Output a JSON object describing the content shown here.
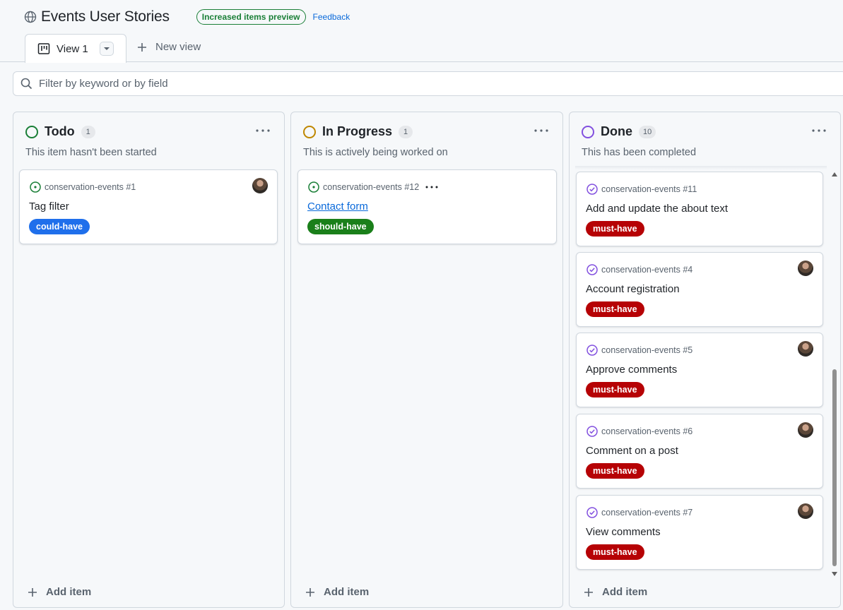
{
  "header": {
    "title": "Events User Stories",
    "preview_badge": "Increased items preview",
    "feedback_link": "Feedback",
    "icon": "globe-icon"
  },
  "tabs": {
    "active_label": "View 1",
    "new_view_label": "New view"
  },
  "filter": {
    "placeholder": "Filter by keyword or by field"
  },
  "columns": [
    {
      "name": "Todo",
      "count": "1",
      "description": "This item hasn't been started",
      "status_color": "#1a7f37",
      "add_label": "Add item",
      "cards": [
        {
          "ref": "conservation-events #1",
          "title": "Tag filter",
          "label": "could-have",
          "label_color": "#1f6feb",
          "icon": "open-issue-icon",
          "has_avatar": true
        }
      ]
    },
    {
      "name": "In Progress",
      "count": "1",
      "description": "This is actively being worked on",
      "status_color": "#bf8700",
      "add_label": "Add item",
      "cards": [
        {
          "ref": "conservation-events #12",
          "title": "Contact form",
          "label": "should-have",
          "label_color": "#1a7f1a",
          "icon": "open-issue-icon",
          "has_avatar": false,
          "link": true
        }
      ]
    },
    {
      "name": "Done",
      "count": "10",
      "description": "This has been completed",
      "status_color": "#8250df",
      "add_label": "Add item",
      "cards": [
        {
          "ref": "conservation-events #11",
          "title": "Add and update the about text",
          "label": "must-have",
          "label_color": "#b60205",
          "icon": "closed-issue-icon",
          "has_avatar": false
        },
        {
          "ref": "conservation-events #4",
          "title": "Account registration",
          "label": "must-have",
          "label_color": "#b60205",
          "icon": "closed-issue-icon",
          "has_avatar": true
        },
        {
          "ref": "conservation-events #5",
          "title": "Approve comments",
          "label": "must-have",
          "label_color": "#b60205",
          "icon": "closed-issue-icon",
          "has_avatar": true
        },
        {
          "ref": "conservation-events #6",
          "title": "Comment on a post",
          "label": "must-have",
          "label_color": "#b60205",
          "icon": "closed-issue-icon",
          "has_avatar": true
        },
        {
          "ref": "conservation-events #7",
          "title": "View comments",
          "label": "must-have",
          "label_color": "#b60205",
          "icon": "closed-issue-icon",
          "has_avatar": true
        }
      ]
    }
  ]
}
